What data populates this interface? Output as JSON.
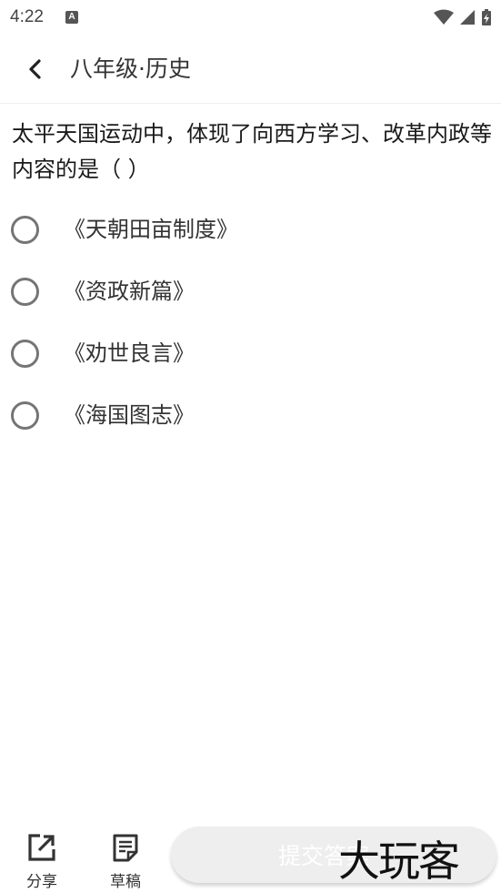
{
  "status_bar": {
    "time": "4:22",
    "notification_icon": "A"
  },
  "app_bar": {
    "title": "八年级·历史"
  },
  "question": {
    "text": "太平天国运动中，体现了向西方学习、改革内政等内容的是（ ）"
  },
  "options": [
    {
      "label": "《天朝田亩制度》"
    },
    {
      "label": "《资政新篇》"
    },
    {
      "label": "《劝世良言》"
    },
    {
      "label": "《海国图志》"
    }
  ],
  "bottom_bar": {
    "share_label": "分享",
    "draft_label": "草稿",
    "submit_label": "提交答案",
    "watermark": "大玩客"
  },
  "colors": {
    "radio": "#757575",
    "submit_bg": "#eeeeee"
  }
}
